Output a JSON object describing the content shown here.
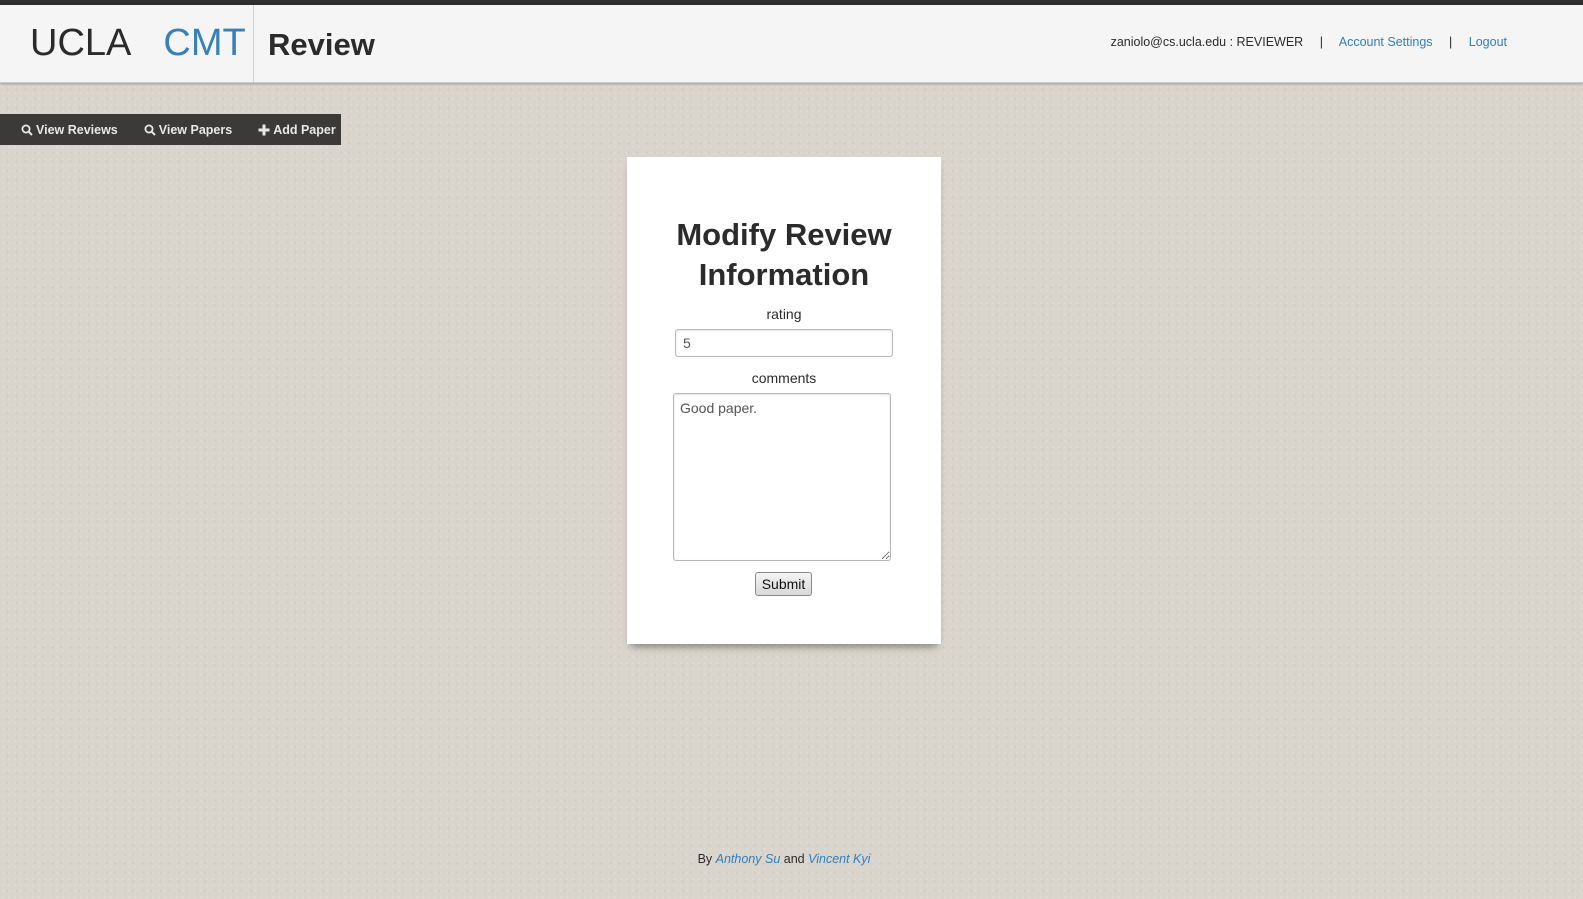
{
  "header": {
    "brand_part1": "UCLA",
    "brand_part2": "CMT",
    "page_heading": "Review",
    "user_info": "zaniolo@cs.ucla.edu : REVIEWER",
    "separator": "|",
    "account_settings": "Account Settings",
    "logout": "Logout"
  },
  "toolbar": {
    "view_reviews": "View Reviews",
    "view_papers": "View Papers",
    "add_paper": "Add Paper",
    "icons": [
      "search-icon",
      "search-icon",
      "plus-icon"
    ]
  },
  "form": {
    "title": "Modify Review Information",
    "rating_label": "rating",
    "rating_value": "5",
    "comments_label": "comments",
    "comments_value": "Good paper.",
    "submit_label": "Submit"
  },
  "footer": {
    "by": "By",
    "author1": "Anthony Su",
    "and": "and",
    "author2": "Vincent Kyi"
  },
  "colors": {
    "accent": "#3a80b8",
    "link": "#2f7fbf",
    "toolbar_bg": "#3b3a38",
    "page_bg": "#d9d4cc"
  }
}
